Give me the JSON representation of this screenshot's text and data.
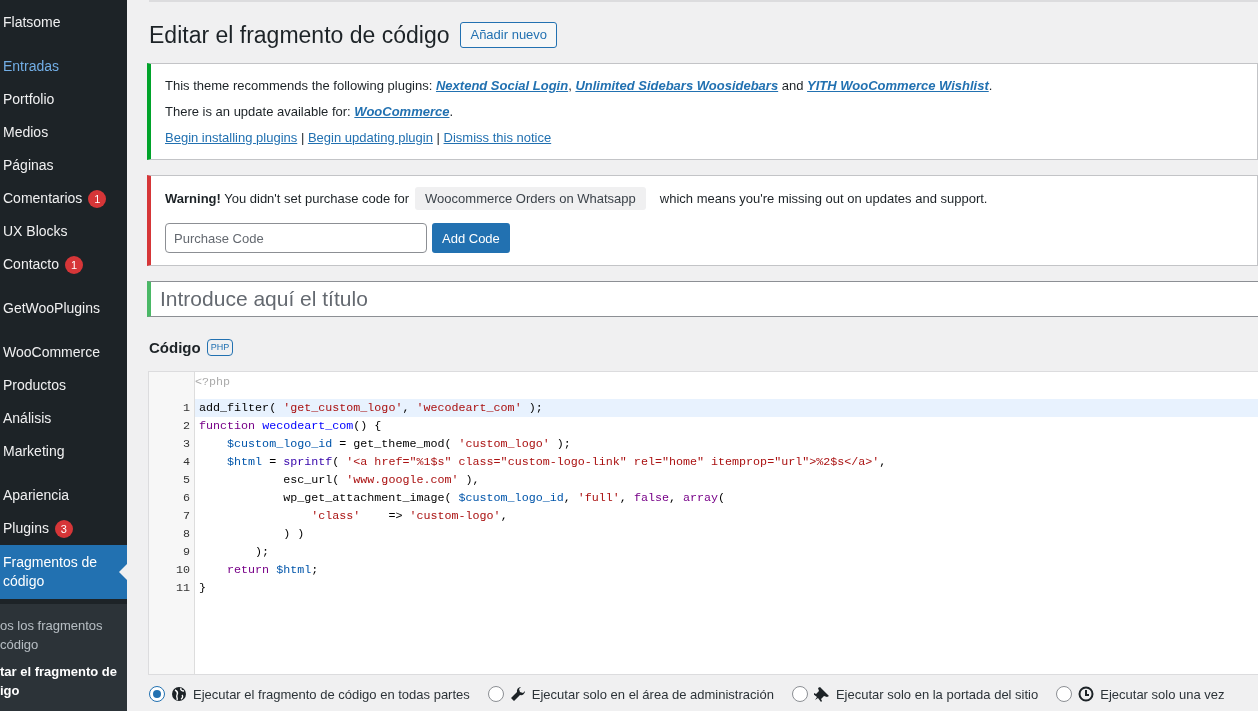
{
  "sidebar": {
    "groups": [
      [
        {
          "label": "Flatsome",
          "hover": false
        }
      ],
      [
        {
          "label": "Entradas",
          "hover": true
        },
        {
          "label": "Portfolio",
          "hover": false
        },
        {
          "label": "Medios",
          "hover": false
        },
        {
          "label": "Páginas",
          "hover": false
        },
        {
          "label": "Comentarios",
          "hover": false,
          "badge": "1"
        },
        {
          "label": "UX Blocks",
          "hover": false
        },
        {
          "label": "Contacto",
          "hover": false,
          "badge": "1"
        }
      ],
      [
        {
          "label": "GetWooPlugins",
          "hover": false
        }
      ],
      [
        {
          "label": "WooCommerce",
          "hover": false
        },
        {
          "label": "Productos",
          "hover": false
        },
        {
          "label": "Análisis",
          "hover": false
        },
        {
          "label": "Marketing",
          "hover": false
        }
      ],
      [
        {
          "label": "Apariencia",
          "hover": false
        },
        {
          "label": "Plugins",
          "hover": false,
          "badge": "3"
        },
        {
          "label": "Fragmentos de código",
          "hover": false,
          "selected": true
        }
      ]
    ],
    "submenu": [
      {
        "lines": [
          "os los fragmentos",
          "código"
        ],
        "selected": false
      },
      {
        "lines": [
          "tar el fragmento de",
          "igo"
        ],
        "selected": true
      }
    ]
  },
  "page": {
    "title": "Editar el fragmento de código",
    "add_button": "Añadir nuevo"
  },
  "plugin_notice": {
    "paragraphs": [
      [
        {
          "kind": "text",
          "text": "This theme recommends the following plugins: "
        },
        {
          "kind": "link",
          "text": "Nextend Social Login"
        },
        {
          "kind": "text",
          "text": ", "
        },
        {
          "kind": "link",
          "text": "Unlimited Sidebars Woosidebars"
        },
        {
          "kind": "text",
          "text": " and "
        },
        {
          "kind": "link",
          "text": "YITH WooCommerce Wishlist"
        },
        {
          "kind": "text",
          "text": "."
        }
      ],
      [
        {
          "kind": "text",
          "text": "There is an update available for: "
        },
        {
          "kind": "link",
          "text": "WooCommerce"
        },
        {
          "kind": "text",
          "text": "."
        }
      ],
      [
        {
          "kind": "action",
          "text": "Begin installing plugins"
        },
        {
          "kind": "text",
          "text": " | "
        },
        {
          "kind": "action",
          "text": "Begin updating plugin"
        },
        {
          "kind": "text",
          "text": " | "
        },
        {
          "kind": "action",
          "text": "Dismiss this notice"
        }
      ]
    ]
  },
  "warning_notice": {
    "message": "**Warning!** You didn't set purchase code for",
    "plugin": "Woocommerce Orders on Whatsapp",
    "message_end": "which means you're missing out on updates and support.",
    "field": {
      "placeholder": "Purchase Code"
    },
    "button": "Add Code"
  },
  "title_field": {
    "placeholder": "Introduce aquí el título"
  },
  "code_section": {
    "heading": "Código",
    "badge": "PHP"
  },
  "editor": {
    "opening_tag": "<?php",
    "lines": [
      {
        "number": "1",
        "highlighted": true,
        "tokens": [
          {
            "kind": "plain",
            "text": "add_filter( "
          },
          {
            "kind": "string",
            "text": "'get_custom_logo'"
          },
          {
            "kind": "plain",
            "text": ", "
          },
          {
            "kind": "string",
            "text": "'wecodeart_com'"
          },
          {
            "kind": "plain",
            "text": " );"
          }
        ]
      },
      {
        "number": "2",
        "highlighted": false,
        "tokens": [
          {
            "kind": "keyword",
            "text": "function "
          },
          {
            "kind": "def",
            "text": "wecodeart_com"
          },
          {
            "kind": "plain",
            "text": "() {"
          }
        ]
      },
      {
        "number": "3",
        "highlighted": false,
        "tokens": [
          {
            "kind": "variable",
            "text": "    $custom_logo_id"
          },
          {
            "kind": "plain",
            "text": " = get_theme_mod( "
          },
          {
            "kind": "string",
            "text": "'custom_logo'"
          },
          {
            "kind": "plain",
            "text": " );"
          }
        ]
      },
      {
        "number": "4",
        "highlighted": false,
        "tokens": [
          {
            "kind": "variable",
            "text": "    $html"
          },
          {
            "kind": "plain",
            "text": " = "
          },
          {
            "kind": "builtin",
            "text": "sprintf"
          },
          {
            "kind": "plain",
            "text": "( "
          },
          {
            "kind": "string",
            "text": "'<a href=\"%1$s\" class=\"custom-logo-link\" rel=\"home\" itemprop=\"url\">%2$s</a>'"
          },
          {
            "kind": "plain",
            "text": ","
          }
        ]
      },
      {
        "number": "5",
        "highlighted": false,
        "tokens": [
          {
            "kind": "plain",
            "text": "            esc_url( "
          },
          {
            "kind": "string",
            "text": "'www.google.com'"
          },
          {
            "kind": "plain",
            "text": " ),"
          }
        ]
      },
      {
        "number": "6",
        "highlighted": false,
        "tokens": [
          {
            "kind": "plain",
            "text": "            wp_get_attachment_image( "
          },
          {
            "kind": "variable",
            "text": "$custom_logo_id"
          },
          {
            "kind": "plain",
            "text": ", "
          },
          {
            "kind": "string",
            "text": "'full'"
          },
          {
            "kind": "plain",
            "text": ", "
          },
          {
            "kind": "keyword",
            "text": "false"
          },
          {
            "kind": "plain",
            "text": ", "
          },
          {
            "kind": "keyword",
            "text": "array"
          },
          {
            "kind": "plain",
            "text": "("
          }
        ]
      },
      {
        "number": "7",
        "highlighted": false,
        "tokens": [
          {
            "kind": "string",
            "text": "                'class'"
          },
          {
            "kind": "plain",
            "text": "    => "
          },
          {
            "kind": "string",
            "text": "'custom-logo'"
          },
          {
            "kind": "plain",
            "text": ","
          }
        ]
      },
      {
        "number": "8",
        "highlighted": false,
        "tokens": [
          {
            "kind": "plain",
            "text": "            ) )"
          }
        ]
      },
      {
        "number": "9",
        "highlighted": false,
        "tokens": [
          {
            "kind": "plain",
            "text": "        );"
          }
        ]
      },
      {
        "number": "10",
        "highlighted": false,
        "tokens": [
          {
            "kind": "keyword",
            "text": "    return "
          },
          {
            "kind": "variable",
            "text": "$html"
          },
          {
            "kind": "plain",
            "text": ";"
          }
        ]
      },
      {
        "number": "11",
        "highlighted": false,
        "tokens": [
          {
            "kind": "plain",
            "text": "}"
          }
        ]
      }
    ]
  },
  "run_options": [
    {
      "label": "Ejecutar el fragmento de código en todas partes",
      "selected": true
    },
    {
      "label": "Ejecutar solo en el área de administración",
      "selected": false
    },
    {
      "label": "Ejecutar solo en la portada del sitio",
      "selected": false
    },
    {
      "label": "Ejecutar solo una vez",
      "selected": false
    }
  ]
}
